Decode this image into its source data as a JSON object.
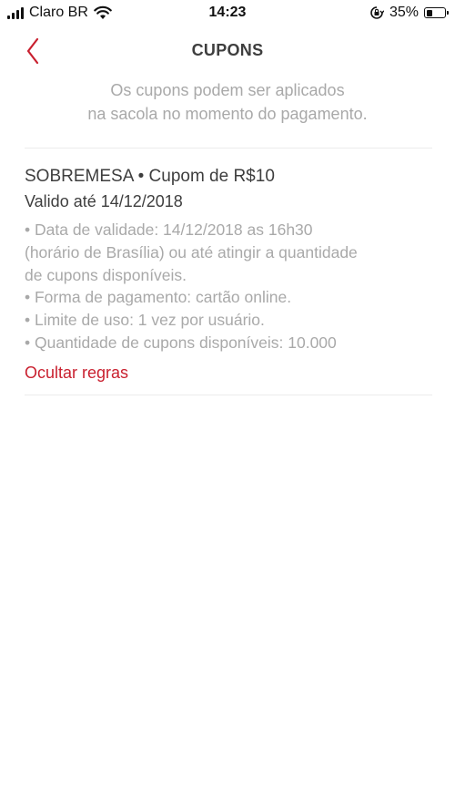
{
  "status_bar": {
    "carrier": "Claro BR",
    "time": "14:23",
    "battery_percent": "35%",
    "battery_level": 0.35,
    "icons": [
      "signal-icon",
      "wifi-icon",
      "orientation-lock-icon",
      "battery-icon"
    ]
  },
  "header": {
    "title": "CUPONS",
    "back_icon": "chevron-left-icon"
  },
  "subtitle": {
    "line1": "Os cupons podem ser aplicados",
    "line2": "na sacola no momento do pagamento."
  },
  "coupon": {
    "title": "SOBREMESA • Cupom de R$10",
    "validity": "Valido até 14/12/2018",
    "rules": [
      "• Data de validade: 14/12/2018 as 16h30",
      "(horário de Brasília) ou até atingir a quantidade",
      "de cupons disponíveis.",
      "• Forma de pagamento: cartão online.",
      "• Limite de uso: 1 vez por usuário.",
      "• Quantidade de cupons disponíveis: 10.000"
    ],
    "toggle_label": "Ocultar regras"
  },
  "colors": {
    "accent": "#c9202f",
    "text": "#3e3e3e",
    "muted": "#a9a9a9",
    "divider": "#ececec"
  }
}
